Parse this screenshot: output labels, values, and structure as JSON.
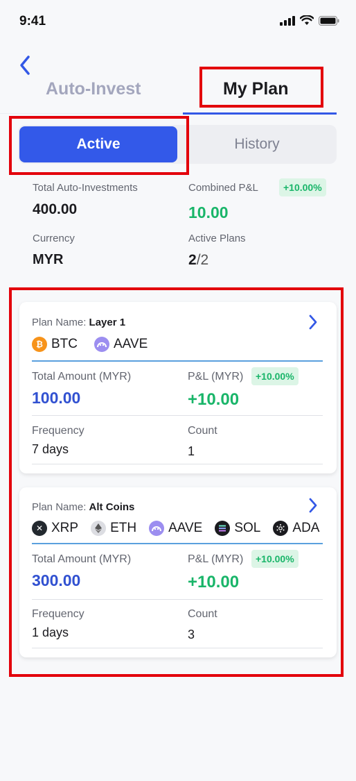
{
  "status": {
    "time": "9:41"
  },
  "tabs": {
    "auto_invest": "Auto-Invest",
    "my_plan": "My Plan"
  },
  "segment": {
    "active": "Active",
    "history": "History"
  },
  "summary": {
    "total_label": "Total Auto-Investments",
    "total_value": "400.00",
    "pl_label": "Combined P&L",
    "pl_badge": "+10.00%",
    "pl_value": "10.00",
    "currency_label": "Currency",
    "currency_value": "MYR",
    "active_label": "Active Plans",
    "active_count": "2",
    "active_total": "/2"
  },
  "plans": [
    {
      "name_label": "Plan Name: ",
      "name": "Layer 1",
      "coins": [
        {
          "symbol": "BTC",
          "icon": "bitcoin-icon",
          "color": "#f7931a"
        },
        {
          "symbol": "AAVE",
          "icon": "aave-icon",
          "color": "#9c8ef0"
        }
      ],
      "amount_label": "Total Amount (MYR)",
      "amount": "100.00",
      "pl_label": "P&L (MYR)",
      "pl_badge": "+10.00%",
      "pl_value": "+10.00",
      "frequency_label": "Frequency",
      "frequency": "7 days",
      "count_label": "Count",
      "count": "1"
    },
    {
      "name_label": "Plan Name: ",
      "name": "Alt Coins",
      "coins": [
        {
          "symbol": "XRP",
          "icon": "xrp-icon",
          "color": "#23292f"
        },
        {
          "symbol": "ETH",
          "icon": "ethereum-icon",
          "color": "#dcdde2"
        },
        {
          "symbol": "AAVE",
          "icon": "aave-icon",
          "color": "#9c8ef0"
        },
        {
          "symbol": "SOL",
          "icon": "solana-icon",
          "color": "#1b1b1f"
        },
        {
          "symbol": "ADA",
          "icon": "cardano-icon",
          "color": "#1b1b1f"
        }
      ],
      "amount_label": "Total Amount (MYR)",
      "amount": "300.00",
      "pl_label": "P&L (MYR)",
      "pl_badge": "+10.00%",
      "pl_value": "+10.00",
      "frequency_label": "Frequency",
      "frequency": "1 days",
      "count_label": "Count",
      "count": "3"
    }
  ],
  "colors": {
    "accent": "#3359e9",
    "positive": "#19b569",
    "highlight": "#e3000b"
  }
}
